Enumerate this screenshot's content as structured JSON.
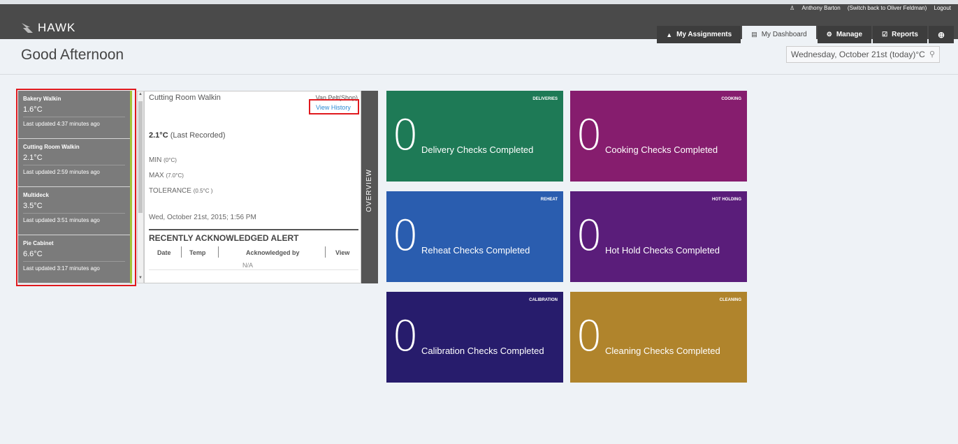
{
  "header": {
    "app_name": "HAWK",
    "user_name": "Anthony Barton",
    "switch_back": "(Switch back to Oliver Feldman)",
    "logout": "Logout",
    "nav": [
      {
        "label": "My Assignments",
        "icon": "car-icon",
        "active": false
      },
      {
        "label": "My Dashboard",
        "icon": "dashboard-icon",
        "active": true
      },
      {
        "label": "Manage",
        "icon": "gear-icon",
        "active": false
      },
      {
        "label": "Reports",
        "icon": "report-icon",
        "active": false
      },
      {
        "label": "",
        "icon": "globe-icon",
        "active": false
      }
    ]
  },
  "page": {
    "greeting": "Good Afternoon",
    "date_selector": "Wednesday, October 21st (today)°C"
  },
  "sensors": [
    {
      "name": "Bakery Walkin",
      "temp": "1.6°C",
      "updated": "Last updated 4:37 minutes ago"
    },
    {
      "name": "Cutting Room Walkin",
      "temp": "2.1°C",
      "updated": "Last updated 2:59 minutes ago"
    },
    {
      "name": "Multideck",
      "temp": "3.5°C",
      "updated": "Last updated 3:51 minutes ago"
    },
    {
      "name": "Pie Cabinet",
      "temp": "6.6°C",
      "updated": "Last updated 3:17 minutes ago"
    }
  ],
  "detail": {
    "name": "Cutting Room Walkin",
    "location": "Van Pelt(Shop)",
    "view_history": "View History",
    "last_value": "2.1°C",
    "last_label": "(Last Recorded)",
    "min_label": "MIN",
    "min_value": "(0°C)",
    "max_label": "MAX",
    "max_value": "(7.0°C)",
    "tol_label": "TOLERANCE",
    "tol_value": "(0.5°C )",
    "timestamp": "Wed, October 21st, 2015; 1:56 PM",
    "alert_title": "RECENTLY ACKNOWLEDGED ALERT",
    "columns": [
      "Date",
      "Temp",
      "Acknowledged by",
      "View"
    ],
    "empty": "N/A",
    "overview_tab": "OVERVIEW"
  },
  "tiles": [
    {
      "category": "DELIVERIES",
      "count": "0",
      "label": "Delivery Checks Completed",
      "color": "#1e7a56"
    },
    {
      "category": "COOKING",
      "count": "0",
      "label": "Cooking Checks Completed",
      "color": "#861d6e"
    },
    {
      "category": "REHEAT",
      "count": "0",
      "label": "Reheat Checks Completed",
      "color": "#2a5daf"
    },
    {
      "category": "HOT HOLDING",
      "count": "0",
      "label": "Hot Hold Checks Completed",
      "color": "#5a1d7a"
    },
    {
      "category": "CALIBRATION",
      "count": "0",
      "label": "Calibration Checks Completed",
      "color": "#271c6c"
    },
    {
      "category": "CLEANING",
      "count": "0",
      "label": "Cleaning Checks Completed",
      "color": "#b0842c"
    }
  ]
}
